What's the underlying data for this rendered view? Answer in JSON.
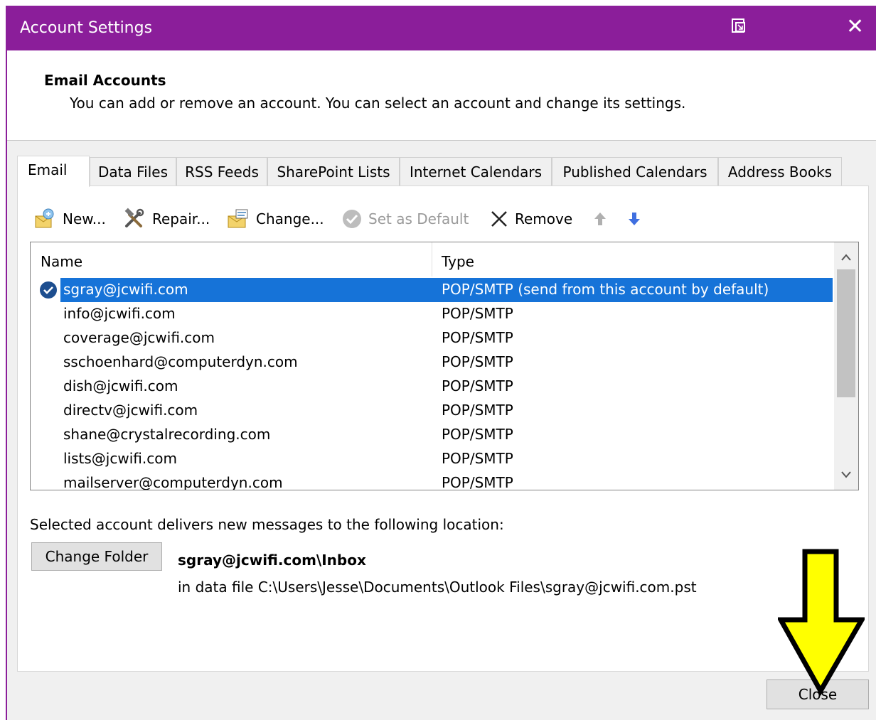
{
  "window": {
    "title": "Account Settings",
    "close_glyph": "✕",
    "accent_color": "#8b1e9a"
  },
  "header": {
    "title": "Email Accounts",
    "description": "You can add or remove an account. You can select an account and change its settings."
  },
  "tabs": [
    {
      "label": "Email",
      "active": true
    },
    {
      "label": "Data Files"
    },
    {
      "label": "RSS Feeds"
    },
    {
      "label": "SharePoint Lists"
    },
    {
      "label": "Internet Calendars"
    },
    {
      "label": "Published Calendars"
    },
    {
      "label": "Address Books"
    }
  ],
  "toolbar": {
    "new_label": "New...",
    "repair_label": "Repair...",
    "change_label": "Change...",
    "set_default_label": "Set as Default",
    "remove_label": "Remove"
  },
  "accounts_list": {
    "columns": {
      "name": "Name",
      "type": "Type"
    },
    "rows": [
      {
        "name": "sgray@jcwifi.com",
        "type": "POP/SMTP (send from this account by default)",
        "selected": true
      },
      {
        "name": "info@jcwifi.com",
        "type": "POP/SMTP"
      },
      {
        "name": "coverage@jcwifi.com",
        "type": "POP/SMTP"
      },
      {
        "name": "sschoenhard@computerdyn.com",
        "type": "POP/SMTP"
      },
      {
        "name": "dish@jcwifi.com",
        "type": "POP/SMTP"
      },
      {
        "name": "directv@jcwifi.com",
        "type": "POP/SMTP"
      },
      {
        "name": "shane@crystalrecording.com",
        "type": "POP/SMTP"
      },
      {
        "name": "lists@jcwifi.com",
        "type": "POP/SMTP"
      },
      {
        "name": "mailserver@computerdyn.com",
        "type": "POP/SMTP"
      }
    ]
  },
  "delivery": {
    "label": "Selected account delivers new messages to the following location:",
    "change_folder_label": "Change Folder",
    "inbox_path": "sgray@jcwifi.com\\Inbox",
    "data_file": "in data file C:\\Users\\Jesse\\Documents\\Outlook Files\\sgray@jcwifi.com.pst"
  },
  "footer": {
    "close_label": "Close"
  },
  "colors": {
    "selection": "#1673d8",
    "arrow_fill": "#ffff00"
  }
}
